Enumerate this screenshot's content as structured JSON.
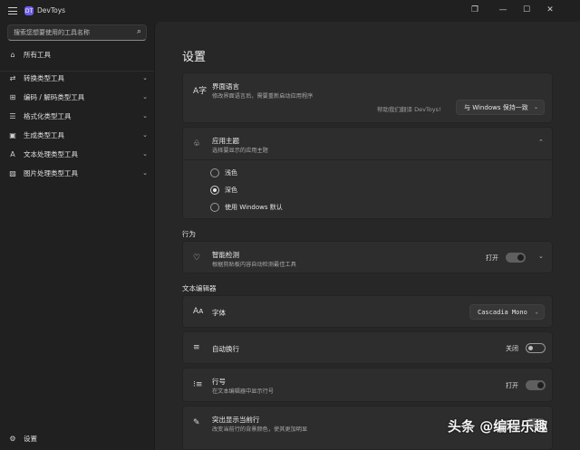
{
  "window": {
    "app_title": "DevToys",
    "logo_glyph": "DT",
    "restore_glyph": "❐",
    "minimize_glyph": "—",
    "maximize_glyph": "☐",
    "close_glyph": "✕"
  },
  "sidebar": {
    "search_placeholder": "搜索您想要使用的工具名称",
    "search_icon": "⌕",
    "all_tools": {
      "label": "所有工具",
      "icon": "⌂"
    },
    "items": [
      {
        "label": "转换类型工具",
        "icon": "⇄"
      },
      {
        "label": "编码 / 解码类型工具",
        "icon": "⊞"
      },
      {
        "label": "格式化类型工具",
        "icon": "☰"
      },
      {
        "label": "生成类型工具",
        "icon": "▣"
      },
      {
        "label": "文本处理类型工具",
        "icon": "A"
      },
      {
        "label": "图片处理类型工具",
        "icon": "▨"
      }
    ],
    "chevron": "⌄",
    "settings": {
      "label": "设置",
      "icon": "⚙"
    }
  },
  "main": {
    "title": "设置",
    "language": {
      "icon": "A字",
      "title": "界面语言",
      "desc": "修改界面语言后，需要重新启动应用程序",
      "link": "帮助我们翻译 DevToys!",
      "value": "与 Windows 保持一致"
    },
    "theme": {
      "icon": "♧",
      "title": "应用主题",
      "desc": "选择要显示的应用主题",
      "options": [
        {
          "label": "浅色",
          "selected": false
        },
        {
          "label": "深色",
          "selected": true
        },
        {
          "label": "使用 Windows 默认",
          "selected": false
        }
      ]
    },
    "behavior_label": "行为",
    "smart_detection": {
      "icon": "♡",
      "title": "智能检测",
      "desc": "根据剪贴板内容自动检测最佳工具",
      "toggle_label": "打开",
      "on": true
    },
    "editor_label": "文本编辑器",
    "font": {
      "icon": "Aᴀ",
      "title": "字体",
      "value": "Cascadia Mono"
    },
    "word_wrap": {
      "icon": "≡",
      "title": "自动换行",
      "toggle_label": "关闭",
      "on": false
    },
    "line_numbers": {
      "icon": "⁝≡",
      "title": "行号",
      "desc": "在文本编辑器中显示行号",
      "toggle_label": "打开",
      "on": true
    },
    "highlight_line": {
      "icon": "✎",
      "title": "突出显示当前行",
      "desc": "改变当前行的背景颜色，使其更加明显",
      "toggle_label": "打开",
      "on": true
    }
  },
  "watermark": "头条 @编程乐趣",
  "colors": {
    "window_bg": "#202020",
    "content_bg": "#272727",
    "card_bg": "#2d2d2d",
    "logo": "#6c5ce7"
  }
}
